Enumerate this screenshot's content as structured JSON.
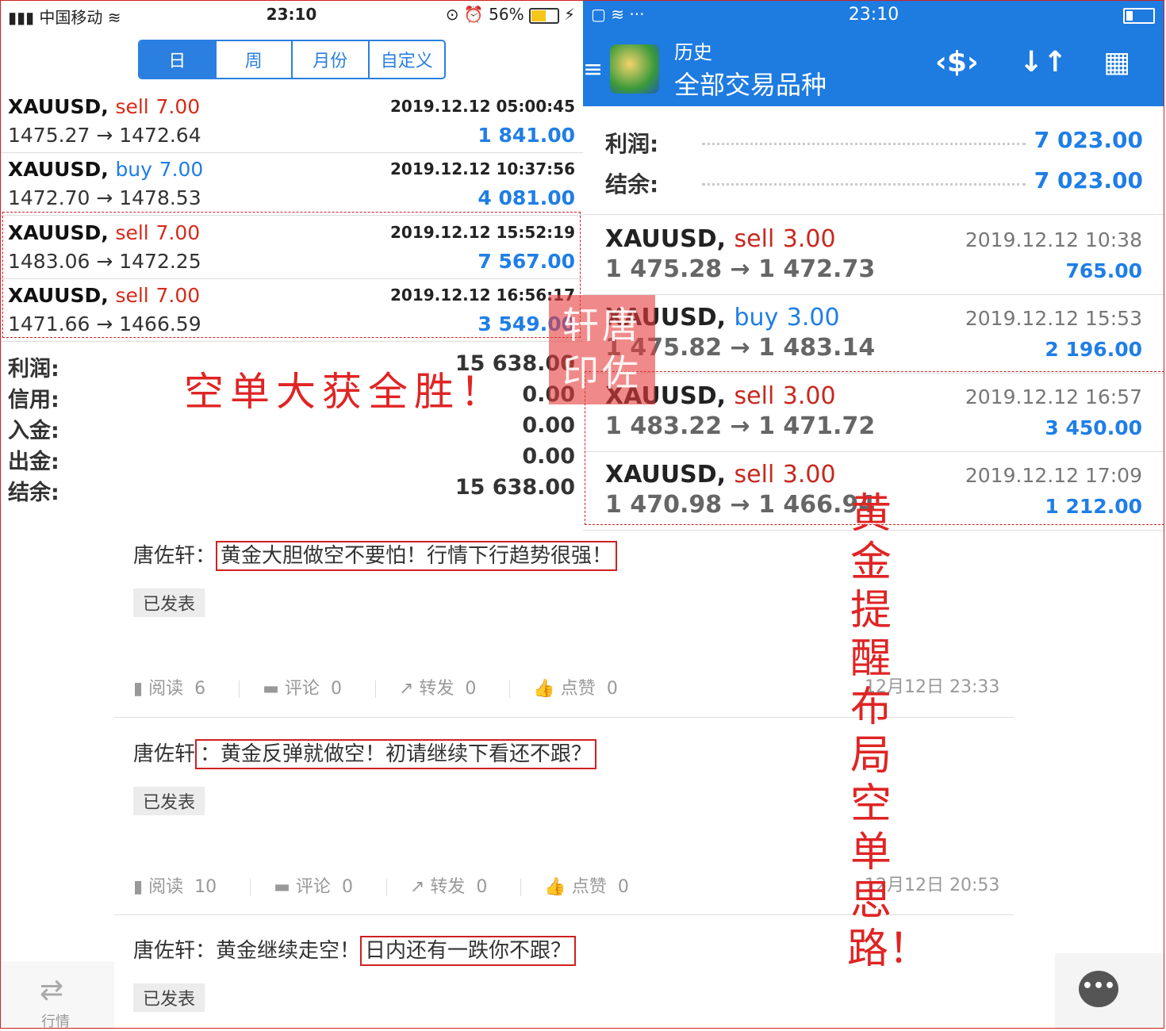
{
  "left": {
    "status": {
      "carrier": "中国移动",
      "time": "23:10",
      "battery": "56%"
    },
    "tabs": [
      "日",
      "周",
      "月份",
      "自定义"
    ],
    "trades": [
      {
        "symbol": "XAUUSD,",
        "side": "sell",
        "lots": "7.00",
        "date": "2019.12.12 05:00:45",
        "prices": "1475.27 → 1472.64",
        "profit": "1 841.00"
      },
      {
        "symbol": "XAUUSD,",
        "side": "buy",
        "lots": "7.00",
        "date": "2019.12.12 10:37:56",
        "prices": "1472.70 → 1478.53",
        "profit": "4 081.00"
      },
      {
        "symbol": "XAUUSD,",
        "side": "sell",
        "lots": "7.00",
        "date": "2019.12.12 15:52:19",
        "prices": "1483.06 → 1472.25",
        "profit": "7 567.00"
      },
      {
        "symbol": "XAUUSD,",
        "side": "sell",
        "lots": "7.00",
        "date": "2019.12.12 16:56:17",
        "prices": "1471.66 → 1466.59",
        "profit": "3 549.00"
      }
    ],
    "summary": [
      {
        "label": "利润:",
        "value": "15 638.00"
      },
      {
        "label": "信用:",
        "value": "0.00"
      },
      {
        "label": "入金:",
        "value": "0.00"
      },
      {
        "label": "出金:",
        "value": "0.00"
      },
      {
        "label": "结余:",
        "value": "15 638.00"
      }
    ]
  },
  "right": {
    "status": {
      "time": "23:10",
      "dots": "···"
    },
    "header": {
      "title_small": "历史",
      "title_large": "全部交易品种"
    },
    "summary": [
      {
        "label": "利润:",
        "value": "7 023.00"
      },
      {
        "label": "结余:",
        "value": "7 023.00"
      }
    ],
    "trades": [
      {
        "symbol": "XAUUSD,",
        "side": "sell",
        "lots": "3.00",
        "date": "2019.12.12 10:38",
        "prices": "1 475.28 → 1 472.73",
        "profit": "765.00"
      },
      {
        "symbol": "XAUUSD,",
        "side": "buy",
        "lots": "3.00",
        "date": "2019.12.12 15:53",
        "prices": "1 475.82 → 1 483.14",
        "profit": "2 196.00"
      },
      {
        "symbol": "XAUUSD,",
        "side": "sell",
        "lots": "3.00",
        "date": "2019.12.12 16:57",
        "prices": "1 483.22 → 1 471.72",
        "profit": "3 450.00"
      },
      {
        "symbol": "XAUUSD,",
        "side": "sell",
        "lots": "3.00",
        "date": "2019.12.12 17:09",
        "prices": "1 470.98 → 1 466.94",
        "profit": "1 212.00"
      }
    ]
  },
  "feed": {
    "posts": [
      {
        "author": "唐佐轩：",
        "text": "黄金大胆做空不要怕！行情下行趋势很强！",
        "published": "已发表",
        "stats": {
          "read_label": "阅读",
          "read": "6",
          "comment_label": "评论",
          "comment": "0",
          "share_label": "转发",
          "share": "0",
          "like_label": "点赞",
          "like": "0"
        },
        "timestamp": "12月12日 23:33"
      },
      {
        "author": "唐佐轩",
        "text": "：黄金反弹就做空！初请继续下看还不跟？",
        "published": "已发表",
        "stats": {
          "read_label": "阅读",
          "read": "10",
          "comment_label": "评论",
          "comment": "0",
          "share_label": "转发",
          "share": "0",
          "like_label": "点赞",
          "like": "0"
        },
        "timestamp": "12月12日 20:53"
      },
      {
        "author": "唐佐轩：黄金继续走空！",
        "text": "日内还有一跌你不跟？",
        "published": "已发表"
      }
    ],
    "tab_label": "行情"
  },
  "annotations": {
    "left": "空单大获全胜！",
    "right": "黄金提醒布局空单思路！",
    "stamp": "轩唐印佐"
  }
}
